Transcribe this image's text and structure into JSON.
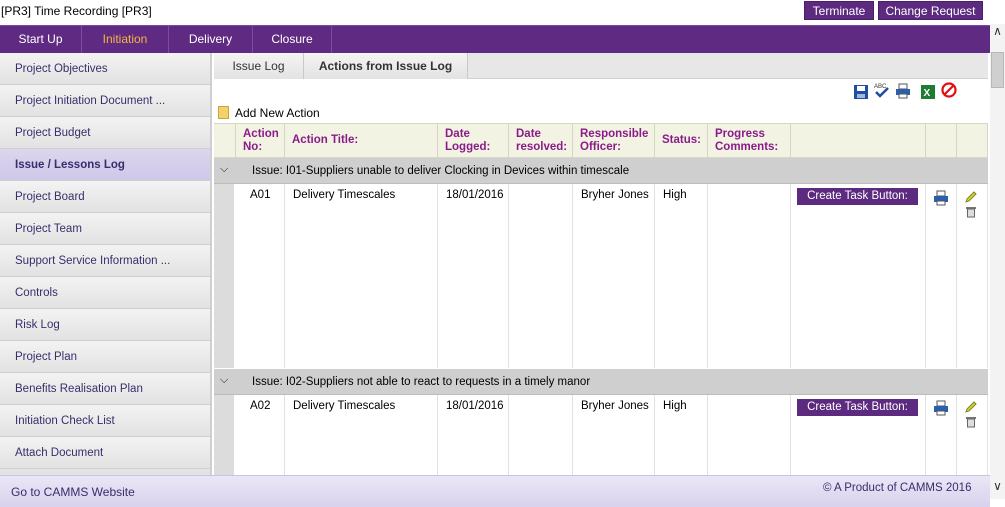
{
  "window": {
    "title": "[PR3] Time Recording [PR3]",
    "terminate_label": "Terminate",
    "change_request_label": "Change Request"
  },
  "nav": {
    "tabs": [
      {
        "label": "Start Up"
      },
      {
        "label": "Initiation"
      },
      {
        "label": "Delivery"
      },
      {
        "label": "Closure"
      }
    ],
    "active": "Initiation"
  },
  "sidebar": {
    "items": [
      {
        "label": "Project Objectives"
      },
      {
        "label": "Project Initiation Document ..."
      },
      {
        "label": "Project Budget"
      },
      {
        "label": "Issue / Lessons Log"
      },
      {
        "label": "Project Board"
      },
      {
        "label": "Project Team"
      },
      {
        "label": "Support Service Information ..."
      },
      {
        "label": "Controls"
      },
      {
        "label": "Risk Log"
      },
      {
        "label": "Project Plan"
      },
      {
        "label": "Benefits Realisation Plan"
      },
      {
        "label": "Initiation Check List"
      },
      {
        "label": "Attach Document"
      }
    ],
    "active": "Issue / Lessons Log"
  },
  "subtabs": [
    {
      "label": "Issue Log"
    },
    {
      "label": "Actions from Issue Log"
    }
  ],
  "toolbar": {
    "icons": [
      "save-icon",
      "spell-check-icon",
      "print-icon",
      "excel-export-icon",
      "cancel-icon"
    ]
  },
  "add_new_label": "Add New Action",
  "grid": {
    "headers": {
      "action_no": [
        "Action",
        "No:"
      ],
      "action_title": "Action Title:",
      "date_logged": [
        "Date",
        "Logged:"
      ],
      "date_resolved": [
        "Date",
        "resolved:"
      ],
      "responsible_officer": [
        "Responsible",
        "Officer:"
      ],
      "status": "Status:",
      "progress_comments": [
        "Progress",
        "Comments:"
      ]
    },
    "groups": [
      {
        "label": "Issue: I01-Suppliers unable to deliver Clocking in Devices within timescale",
        "rows": [
          {
            "action_no": "A01",
            "title": "Delivery Timescales",
            "date_logged": "18/01/2016",
            "date_resolved": "",
            "officer": "Bryher Jones",
            "status": "High",
            "comments": "",
            "task_button": "Create Task Button:"
          }
        ]
      },
      {
        "label": "Issue: I02-Suppliers not able to react to requests in a timely manor",
        "rows": [
          {
            "action_no": "A02",
            "title": "Delivery Timescales",
            "date_logged": "18/01/2016",
            "date_resolved": "",
            "officer": "Bryher Jones",
            "status": "High",
            "comments": "",
            "task_button": "Create Task Button:"
          }
        ]
      }
    ]
  },
  "footer": {
    "link": "Go to CAMMS Website",
    "copyright": "© A Product of CAMMS 2016"
  },
  "colors": {
    "brand_purple": "#5f2b82",
    "active_tab": "#f7b340",
    "header_text": "#8a1c8a"
  }
}
